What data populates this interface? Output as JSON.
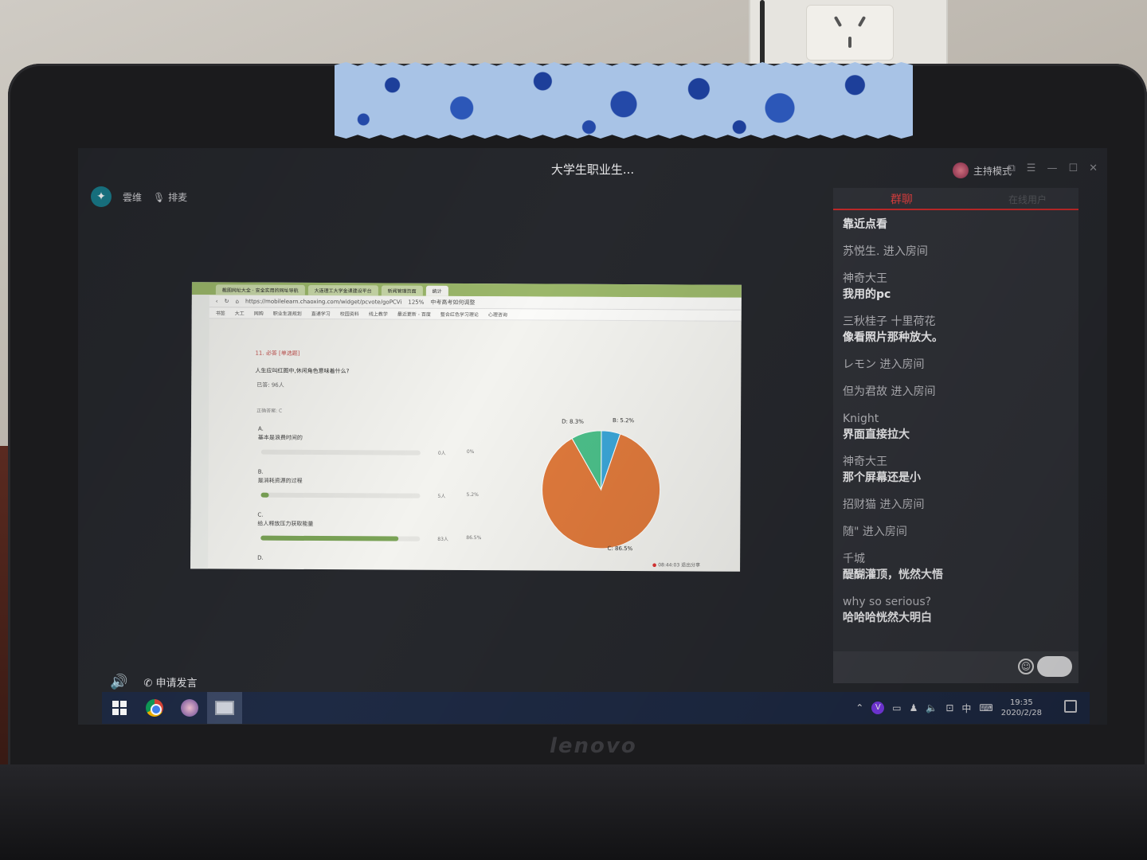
{
  "app": {
    "title": "大学生职业生...",
    "host_mode": "主持模式",
    "top_left_name": "雲维",
    "top_left_mic_label": "排麦"
  },
  "shared_screen": {
    "tabs": [
      "截图网址大全 · 安全实用的网址导航",
      "大连理工大学金课建设平台",
      "新闻管理页面",
      "统计",
      "中考高考如何调整"
    ],
    "url": "https://mobilelearn.chaoxing.com/widget/pcvote/goPCVi",
    "zoom": "125%",
    "bookmarks": [
      "书签",
      "大工",
      "网购",
      "职业生涯规划",
      "直通学习",
      "校园资料",
      "线上教学",
      "最近更新 - 百度",
      "整合红色学习理论",
      "心理咨询"
    ],
    "question_title": "11. 必答 [单选题]",
    "question_text": "人生应叫红图中,休闲角色意味着什么?",
    "answered": "已答: 96人",
    "correct_answer": "正确答案: C",
    "options": [
      {
        "letter": "A.",
        "text": "基本是浪费时间的",
        "count": "0人",
        "pct": "0%",
        "fraction": 0.0
      },
      {
        "letter": "B.",
        "text": "是消耗资源的过程",
        "count": "5人",
        "pct": "5.2%",
        "fraction": 0.052
      },
      {
        "letter": "C.",
        "text": "给人释放压力获取能量",
        "count": "83人",
        "pct": "86.5%",
        "fraction": 0.865
      },
      {
        "letter": "D.",
        "text": "",
        "count": "",
        "pct": "",
        "fraction": 0.0
      }
    ],
    "recording": "08:44:03",
    "exit_share": "退出分享"
  },
  "chart_data": {
    "type": "pie",
    "title": "",
    "slices": [
      {
        "label": "B: 5.2%",
        "value": 5.2,
        "color": "#3ba6d8"
      },
      {
        "label": "C: 86.5%",
        "value": 86.5,
        "color": "#e07a3c"
      },
      {
        "label": "D: 8.3%",
        "value": 8.3,
        "color": "#4cc08a"
      }
    ]
  },
  "chat": {
    "tab": "群聊",
    "tab_right": "在线用户",
    "messages": [
      {
        "name": "靠近点看",
        "body": "",
        "heading": true
      },
      {
        "name": "苏悦生. 进入房间",
        "body": ""
      },
      {
        "name": "神奇大王",
        "body": "我用的pc"
      },
      {
        "name": "三秋桂子 十里荷花",
        "body": "像看照片那种放大。"
      },
      {
        "name": "レモン 进入房间",
        "body": ""
      },
      {
        "name": "但为君故 进入房间",
        "body": ""
      },
      {
        "name": "Knight",
        "body": "界面直接拉大"
      },
      {
        "name": "神奇大王",
        "body": "那个屏幕还是小"
      },
      {
        "name": "招财猫 进入房间",
        "body": ""
      },
      {
        "name": "随\" 进入房间",
        "body": ""
      },
      {
        "name": "千城",
        "body": "醍醐灌顶，恍然大悟"
      },
      {
        "name": "why so serious?",
        "body": "哈哈哈恍然大明白"
      }
    ]
  },
  "controls": {
    "apply_speak": "申请发言"
  },
  "taskbar": {
    "ime": "中",
    "time": "19:35",
    "date": "2020/2/28"
  },
  "bezel": {
    "brand": "lenovo"
  }
}
